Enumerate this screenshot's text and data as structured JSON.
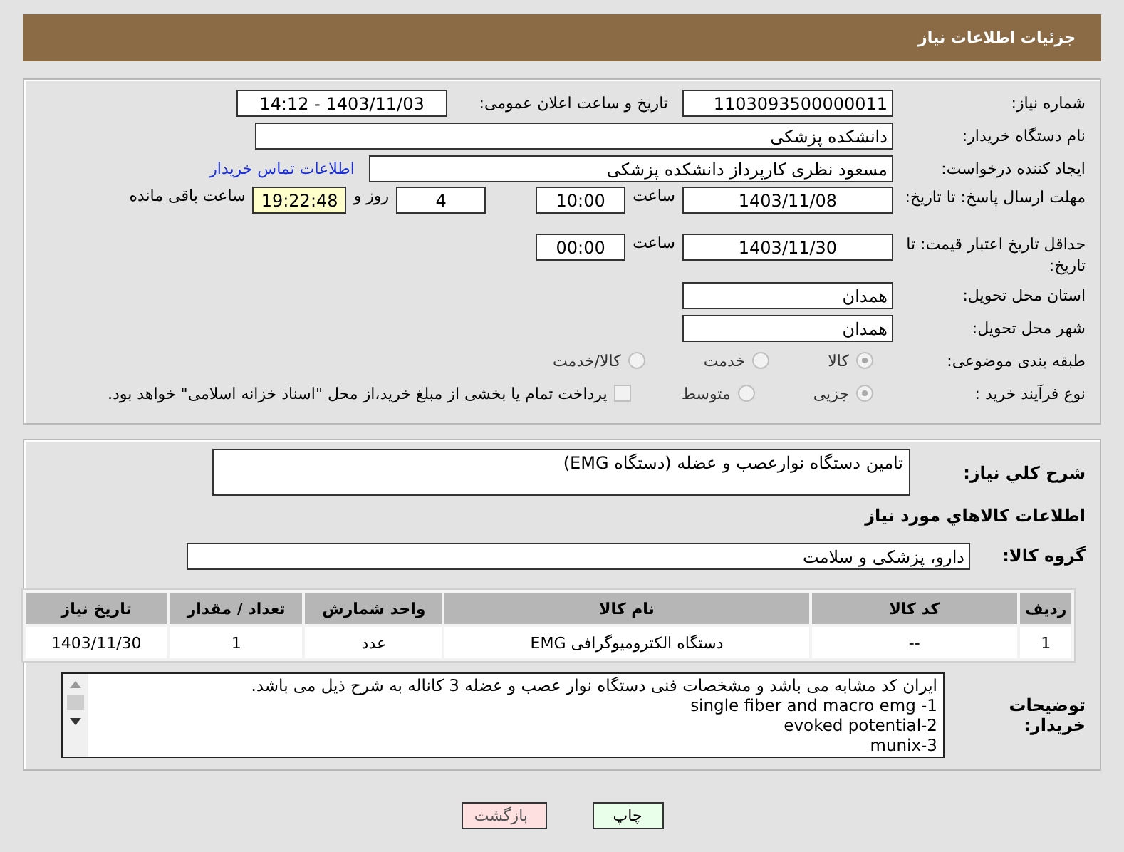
{
  "header": {
    "title": "جزئیات اطلاعات نیاز"
  },
  "need_number": {
    "label": "شماره نیاز:",
    "value": "1103093500000011"
  },
  "announce": {
    "label": "تاریخ و ساعت اعلان عمومی:",
    "value": "1403/11/03 - 14:12"
  },
  "buyer": {
    "label": "نام دستگاه خریدار:",
    "value": "دانشکده پزشکی"
  },
  "requester": {
    "label": "ایجاد کننده درخواست:",
    "value": "مسعود نظری کارپرداز دانشکده پزشکی",
    "link": "اطلاعات تماس خریدار"
  },
  "deadline": {
    "label": "مهلت ارسال پاسخ: تا تاریخ:",
    "date": "1403/11/08",
    "time_label": "ساعت",
    "time": "10:00",
    "days": "4",
    "days_label": "روز و",
    "remaining": "19:22:48",
    "remaining_label": "ساعت باقی مانده"
  },
  "validity": {
    "label": "حداقل تاریخ اعتبار قیمت: تا تاریخ:",
    "date": "1403/11/30",
    "time_label": "ساعت",
    "time": "00:00"
  },
  "province": {
    "label": "استان محل تحویل:",
    "value": "همدان"
  },
  "city": {
    "label": "شهر محل تحویل:",
    "value": "همدان"
  },
  "category": {
    "label": "طبقه بندی موضوعی:",
    "options": [
      {
        "label": "کالا",
        "selected": true
      },
      {
        "label": "خدمت",
        "selected": false
      },
      {
        "label": "کالا/خدمت",
        "selected": false
      }
    ]
  },
  "process": {
    "label": "نوع فرآیند خرید :",
    "options": [
      {
        "label": "جزیی",
        "selected": true
      },
      {
        "label": "متوسط",
        "selected": false
      }
    ],
    "payment": {
      "checked": false,
      "text": "پرداخت تمام یا بخشی از مبلغ خرید،از محل \"اسناد خزانه اسلامی\" خواهد بود."
    }
  },
  "description": {
    "label": "شرح کلي نياز:",
    "value": "تامین دستگاه نوارعصب و عضله (دستگاه EMG)"
  },
  "goods_title": "اطلاعات کالاهاي مورد نياز",
  "goods_group": {
    "label": "گروه کالا:",
    "value": "دارو، پزشکی و سلامت"
  },
  "table": {
    "columns": [
      "ردیف",
      "کد کالا",
      "نام کالا",
      "واحد شمارش",
      "تعداد / مقدار",
      "تاریخ نیاز"
    ],
    "rows": [
      [
        "1",
        "--",
        "دستگاه الکترومیوگرافی EMG",
        "عدد",
        "1",
        "1403/11/30"
      ]
    ]
  },
  "buyer_notes": {
    "label": "توضیحات خریدار:",
    "lines": [
      "ایران کد مشابه می باشد و مشخصات فنی دستگاه نوار عصب و عضله 3 کاناله به شرح ذیل می باشد.",
      "single fiber and macro emg -1",
      "evoked potential-2",
      "munix-3"
    ]
  },
  "buttons": [
    {
      "label": "چاپ",
      "kind": "print"
    },
    {
      "label": "بازگشت",
      "kind": "back"
    }
  ]
}
